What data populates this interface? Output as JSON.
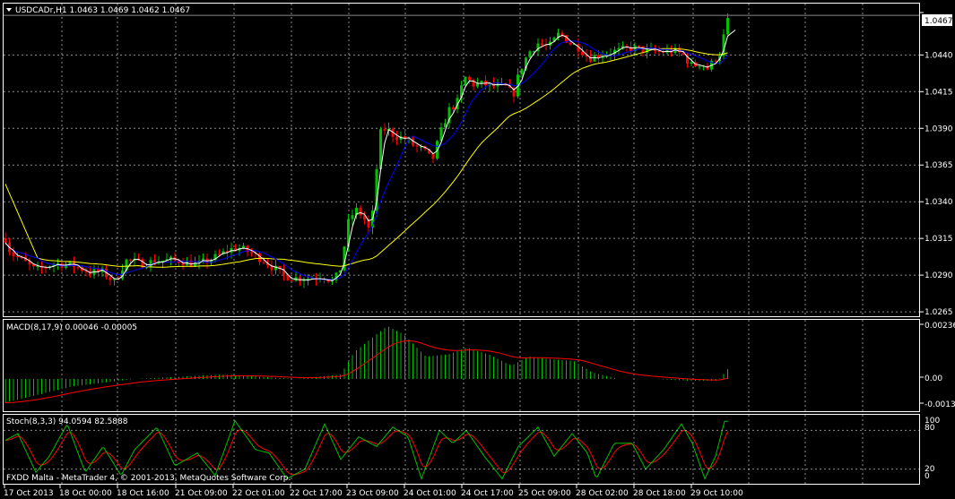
{
  "window": {
    "symbol_header": "USDCADr,H1  1.0463 1.0469 1.0462 1.0467",
    "copyright": "FXDD Malta - MetaTrader 4, © 2001-2013, MetaQuotes Software Corp."
  },
  "colors": {
    "background": "#000000",
    "grid": "#ffffff",
    "bull_candle": "#00c000",
    "bear_candle": "#ff0000",
    "ma_fast": "#ffffff",
    "ma_mid": "#0000ff",
    "ma_slow": "#ffff00",
    "macd_hist": "#00c000",
    "macd_signal": "#ff0000",
    "stoch_main": "#00c000",
    "stoch_signal": "#ff0000",
    "price_label_bg": "#ffffff"
  },
  "price_axis": {
    "current_price_label": "1.0467",
    "ticks": [
      "1.0440",
      "1.0415",
      "1.0390",
      "1.0365",
      "1.0340",
      "1.0315",
      "1.0290",
      "1.0265"
    ]
  },
  "macd_panel": {
    "title": "MACD(8,17,9) 0.00046 -0.00005",
    "ticks": [
      "0.00236",
      "0.00",
      "-0.00133"
    ]
  },
  "stoch_panel": {
    "title": "Stoch(8,3,3) 94.0594 82.5888",
    "ticks": [
      "100",
      "80",
      "20",
      "0"
    ]
  },
  "time_axis": {
    "labels": [
      "17 Oct 2013",
      "18 Oct 00:00",
      "18 Oct 16:00",
      "21 Oct 09:00",
      "22 Oct 01:00",
      "22 Oct 17:00",
      "23 Oct 09:00",
      "24 Oct 01:00",
      "24 Oct 17:00",
      "25 Oct 09:00",
      "28 Oct 02:00",
      "28 Oct 18:00",
      "29 Oct 10:00"
    ]
  },
  "chart_data": {
    "type": "candlestick",
    "symbol": "USDCADr",
    "timeframe": "H1",
    "ylim": [
      1.0265,
      1.047
    ],
    "price_path": [
      [
        0,
        1.0325
      ],
      [
        12,
        1.0305
      ],
      [
        25,
        1.03
      ],
      [
        40,
        1.0293
      ],
      [
        60,
        1.0298
      ],
      [
        80,
        1.0297
      ],
      [
        100,
        1.0292
      ],
      [
        115,
        1.0292
      ],
      [
        128,
        1.0285
      ],
      [
        140,
        1.03
      ],
      [
        160,
        1.0298
      ],
      [
        180,
        1.03
      ],
      [
        200,
        1.03
      ],
      [
        220,
        1.0297
      ],
      [
        240,
        1.0302
      ],
      [
        255,
        1.0307
      ],
      [
        265,
        1.0309
      ],
      [
        280,
        1.0305
      ],
      [
        295,
        1.03
      ],
      [
        315,
        1.029
      ],
      [
        330,
        1.0288
      ],
      [
        345,
        1.0288
      ],
      [
        360,
        1.029
      ],
      [
        372,
        1.0285
      ],
      [
        380,
        1.0295
      ],
      [
        388,
        1.0325
      ],
      [
        396,
        1.0335
      ],
      [
        405,
        1.033
      ],
      [
        412,
        1.032
      ],
      [
        418,
        1.034
      ],
      [
        422,
        1.0385
      ],
      [
        430,
        1.039
      ],
      [
        440,
        1.0385
      ],
      [
        452,
        1.0383
      ],
      [
        462,
        1.0378
      ],
      [
        472,
        1.0375
      ],
      [
        482,
        1.0368
      ],
      [
        492,
        1.0388
      ],
      [
        500,
        1.0402
      ],
      [
        510,
        1.0408
      ],
      [
        518,
        1.0425
      ],
      [
        528,
        1.042
      ],
      [
        540,
        1.042
      ],
      [
        555,
        1.0418
      ],
      [
        565,
        1.0418
      ],
      [
        572,
        1.0412
      ],
      [
        580,
        1.043
      ],
      [
        590,
        1.0442
      ],
      [
        600,
        1.0448
      ],
      [
        612,
        1.0445
      ],
      [
        624,
        1.0455
      ],
      [
        636,
        1.0448
      ],
      [
        646,
        1.0445
      ],
      [
        656,
        1.0438
      ],
      [
        668,
        1.044
      ],
      [
        680,
        1.0442
      ],
      [
        692,
        1.0443
      ],
      [
        705,
        1.0445
      ],
      [
        720,
        1.0443
      ],
      [
        735,
        1.0442
      ],
      [
        750,
        1.0443
      ],
      [
        762,
        1.044
      ],
      [
        772,
        1.0432
      ],
      [
        782,
        1.0435
      ],
      [
        790,
        1.043
      ],
      [
        796,
        1.0437
      ],
      [
        804,
        1.0442
      ],
      [
        810,
        1.0463
      ]
    ],
    "macd_hist_path": [
      [
        0,
        -0.00133
      ],
      [
        80,
        -0.0004
      ],
      [
        150,
        0.0
      ],
      [
        250,
        0.0002
      ],
      [
        330,
        0.0
      ],
      [
        380,
        0.0002
      ],
      [
        395,
        0.0012
      ],
      [
        420,
        0.002
      ],
      [
        432,
        0.00236
      ],
      [
        450,
        0.002
      ],
      [
        475,
        0.001
      ],
      [
        500,
        0.0011
      ],
      [
        520,
        0.0014
      ],
      [
        545,
        0.0011
      ],
      [
        570,
        0.0006
      ],
      [
        590,
        0.001
      ],
      [
        610,
        0.0009
      ],
      [
        640,
        0.0008
      ],
      [
        660,
        0.0003
      ],
      [
        690,
        0.0
      ],
      [
        730,
        0.0
      ],
      [
        770,
        -0.0001
      ],
      [
        800,
        -0.0001
      ],
      [
        812,
        0.00046
      ]
    ],
    "stoch_path": [
      [
        0,
        60
      ],
      [
        20,
        75
      ],
      [
        40,
        15
      ],
      [
        55,
        40
      ],
      [
        75,
        90
      ],
      [
        95,
        15
      ],
      [
        115,
        55
      ],
      [
        135,
        10
      ],
      [
        150,
        50
      ],
      [
        175,
        85
      ],
      [
        195,
        25
      ],
      [
        220,
        45
      ],
      [
        240,
        10
      ],
      [
        262,
        95
      ],
      [
        285,
        50
      ],
      [
        300,
        45
      ],
      [
        320,
        5
      ],
      [
        340,
        20
      ],
      [
        362,
        90
      ],
      [
        380,
        35
      ],
      [
        400,
        70
      ],
      [
        420,
        55
      ],
      [
        438,
        85
      ],
      [
        455,
        70
      ],
      [
        470,
        5
      ],
      [
        490,
        80
      ],
      [
        505,
        60
      ],
      [
        520,
        80
      ],
      [
        540,
        40
      ],
      [
        560,
        5
      ],
      [
        578,
        55
      ],
      [
        600,
        85
      ],
      [
        618,
        40
      ],
      [
        638,
        75
      ],
      [
        655,
        45
      ],
      [
        665,
        5
      ],
      [
        685,
        60
      ],
      [
        705,
        60
      ],
      [
        720,
        20
      ],
      [
        740,
        50
      ],
      [
        760,
        90
      ],
      [
        772,
        60
      ],
      [
        786,
        5
      ],
      [
        798,
        40
      ],
      [
        808,
        94
      ]
    ],
    "current": {
      "open": 1.0463,
      "high": 1.0469,
      "low": 1.0462,
      "close": 1.0467
    },
    "macd_values": {
      "main": 0.00046,
      "signal": -5e-05
    },
    "stoch_values": {
      "main": 94.0594,
      "signal": 82.5888
    }
  }
}
